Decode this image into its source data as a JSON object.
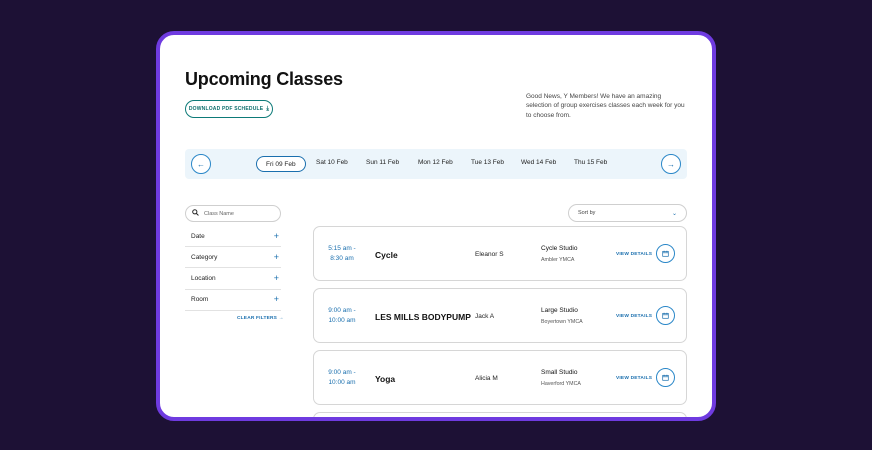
{
  "header": {
    "title": "Upcoming Classes",
    "pdf_button": "DOWNLOAD PDF SCHEDULE",
    "promo": "Good News, Y Members! We have an amazing selection of group exercises classes each week for you to choose from."
  },
  "dates": [
    "Fri 09 Feb",
    "Sat 10 Feb",
    "Sun 11 Feb",
    "Mon 12 Feb",
    "Tue 13 Feb",
    "Wed 14 Feb",
    "Thu 15 Feb"
  ],
  "selected_date": "Fri 09 Feb",
  "search": {
    "placeholder": "Class Name",
    "value": ""
  },
  "filters": [
    "Date",
    "Category",
    "Location",
    "Room"
  ],
  "clear_filters": "CLEAR FILTERS",
  "sort": {
    "placeholder": "Sort by"
  },
  "classes": [
    {
      "start": "5:15 am -",
      "end": "8:30 am",
      "name": "Cycle",
      "instructor": "Eleanor S",
      "studio": "Cycle Studio",
      "branch": "Ambler YMCA",
      "details": "VIEW DETAILS"
    },
    {
      "start": "9:00 am -",
      "end": "10:00 am",
      "name": "LES MILLS BODYPUMP",
      "instructor": "Jack A",
      "studio": "Large Studio",
      "branch": "Boyertown YMCA",
      "details": "VIEW DETAILS"
    },
    {
      "start": "9:00 am -",
      "end": "10:00 am",
      "name": "Yoga",
      "instructor": "Alicia M",
      "studio": "Small Studio",
      "branch": "Haverford YMCA",
      "details": "VIEW DETAILS"
    }
  ],
  "colors": {
    "background": "#1d1135",
    "frame": "#6f3be0",
    "accent": "#1a6fae",
    "teal": "#0d7a78",
    "datebar": "#ecf5fb"
  },
  "icons": [
    "download-icon",
    "arrow-left-icon",
    "arrow-right-icon",
    "search-icon",
    "plus-icon",
    "chevron-down-icon",
    "calendar-icon"
  ]
}
